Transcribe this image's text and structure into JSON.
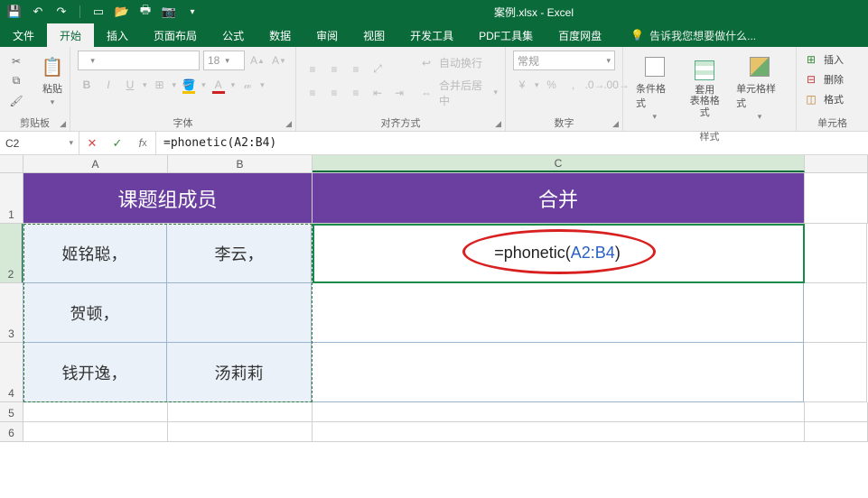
{
  "titlebar": {
    "title": "案例.xlsx - Excel"
  },
  "tabs": {
    "file": "文件",
    "items": [
      "开始",
      "插入",
      "页面布局",
      "公式",
      "数据",
      "审阅",
      "视图",
      "开发工具",
      "PDF工具集",
      "百度网盘"
    ],
    "active_index": 0,
    "tell_me": "告诉我您想要做什么..."
  },
  "ribbon": {
    "clipboard": {
      "paste": "粘贴",
      "label": "剪贴板"
    },
    "font": {
      "size": "18",
      "label": "字体",
      "bold": "B",
      "italic": "I",
      "underline": "U"
    },
    "align": {
      "wrap": "自动换行",
      "merge": "合并后居中",
      "label": "对齐方式"
    },
    "number": {
      "format": "常规",
      "label": "数字"
    },
    "styles": {
      "cf": "条件格式",
      "tbl": "套用\n表格格式",
      "cell": "单元格样式",
      "label": "样式"
    },
    "cells": {
      "insert": "插入",
      "delete": "删除",
      "format": "格式",
      "label": "单元格"
    }
  },
  "fbar": {
    "namebox": "C2",
    "formula": "=phonetic(A2:B4)"
  },
  "sheet": {
    "cols": [
      "A",
      "B",
      "C"
    ],
    "row_headers": [
      "1",
      "2",
      "3",
      "4",
      "5",
      "6"
    ],
    "header_ab": "课题组成员",
    "header_c": "合并",
    "data": [
      {
        "a": "姬铭聪，",
        "b": "李云，"
      },
      {
        "a": "贺顿，",
        "b": ""
      },
      {
        "a": "钱开逸，",
        "b": "汤莉莉"
      }
    ],
    "c2_formula": {
      "prefix": "=phonetic",
      "open": "(",
      "ref": "A2:B4",
      "close": ")"
    }
  }
}
